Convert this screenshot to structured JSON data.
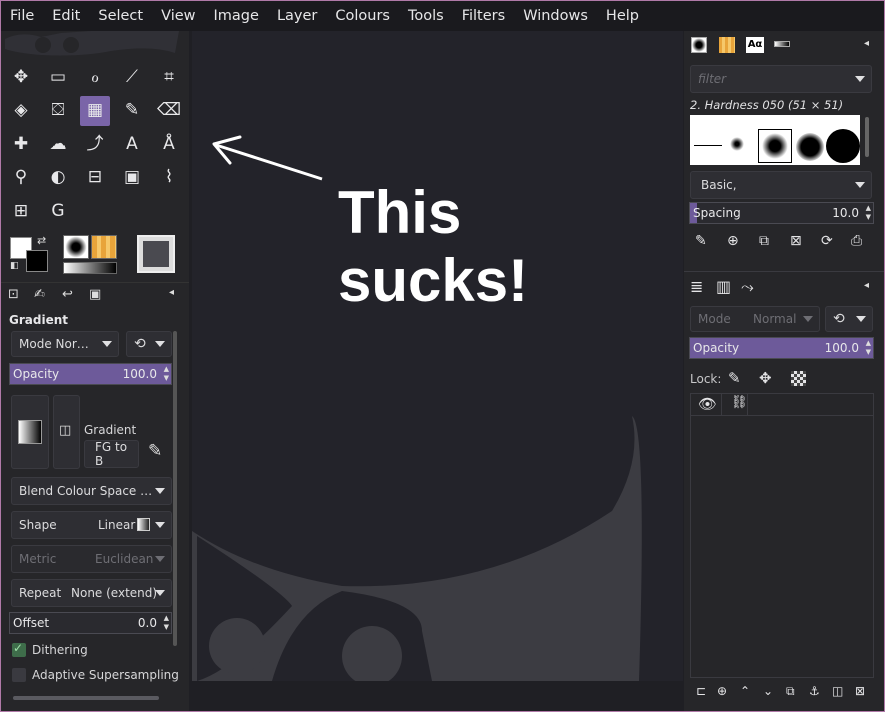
{
  "menubar": {
    "items": [
      "File",
      "Edit",
      "Select",
      "View",
      "Image",
      "Layer",
      "Colours",
      "Tools",
      "Filters",
      "Windows",
      "Help"
    ]
  },
  "toolbox": {
    "tools": [
      {
        "name": "move-tool-icon",
        "glyph": "✥"
      },
      {
        "name": "rect-select-icon",
        "glyph": "▭"
      },
      {
        "name": "lasso-icon",
        "glyph": "ℴ"
      },
      {
        "name": "fuzzy-select-icon",
        "glyph": "⟋"
      },
      {
        "name": "crop-icon",
        "glyph": "⌗"
      },
      {
        "name": "transform-icon",
        "glyph": "◈"
      },
      {
        "name": "bucket-fill-icon",
        "glyph": "⛋"
      },
      {
        "name": "gradient-tool-icon",
        "glyph": "▦"
      },
      {
        "name": "paintbrush-icon",
        "glyph": "✎"
      },
      {
        "name": "eraser-icon",
        "glyph": "⌫"
      },
      {
        "name": "heal-icon",
        "glyph": "✚"
      },
      {
        "name": "smudge-icon",
        "glyph": "☁"
      },
      {
        "name": "paths-icon",
        "glyph": "⤴"
      },
      {
        "name": "text-tool-icon",
        "glyph": "A"
      },
      {
        "name": "measure-icon",
        "glyph": "Å"
      },
      {
        "name": "zoom-icon",
        "glyph": "⚲"
      },
      {
        "name": "dodge-burn-icon",
        "glyph": "◐"
      },
      {
        "name": "levels-icon",
        "glyph": "⊟"
      },
      {
        "name": "curves-icon",
        "glyph": "▣"
      },
      {
        "name": "warp-icon",
        "glyph": "⌇"
      },
      {
        "name": "offset-icon",
        "glyph": "⊞"
      },
      {
        "name": "gegl-icon",
        "glyph": "G"
      }
    ],
    "selected_tool": "gradient-tool-icon"
  },
  "tool_options": {
    "title": "Gradient",
    "mode": "Mode Nor…",
    "opacity_label": "Opacity",
    "opacity_value": "100.0",
    "opacity_fraction": 1.0,
    "gradient_label": "Gradient",
    "gradient_name": "FG to B",
    "blend_space": "Blend Colour Space …",
    "shape_label": "Shape",
    "shape_value": "Linear",
    "metric_label": "Metric",
    "metric_value": "Euclidean",
    "repeat_label": "Repeat",
    "repeat_value": "None (extend)",
    "offset_label": "Offset",
    "offset_value": "0.0",
    "dithering_label": "Dithering",
    "dithering_checked": true,
    "adaptive_label": "Adaptive Supersampling",
    "adaptive_checked": false
  },
  "annotation": {
    "line1": "This",
    "line2": "sucks!"
  },
  "brushes": {
    "filter_placeholder": "filter",
    "current_brush": "2. Hardness 050 (51 × 51)",
    "preset": "Basic,",
    "spacing_label": "Spacing",
    "spacing_value": "10.0",
    "spacing_fraction": 0.04
  },
  "layers": {
    "mode_label": "Mode",
    "mode_value": "Normal",
    "opacity_label": "Opacity",
    "opacity_value": "100.0",
    "opacity_fraction": 1.0,
    "lock_label": "Lock:"
  }
}
